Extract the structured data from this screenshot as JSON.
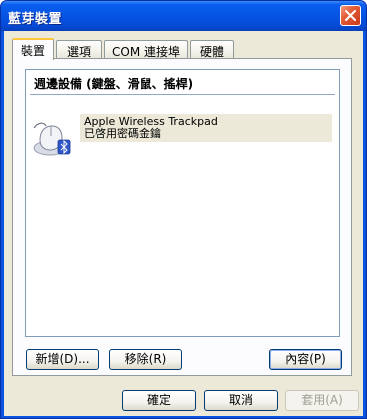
{
  "window": {
    "title": "藍芽裝置"
  },
  "tabs": [
    {
      "label": "裝置",
      "active": true
    },
    {
      "label": "選項",
      "active": false
    },
    {
      "label": "COM 連接埠",
      "active": false
    },
    {
      "label": "硬體",
      "active": false
    }
  ],
  "device_list": {
    "group_header": "週邊設備 (鍵盤、滑鼠、搖桿)",
    "devices": [
      {
        "name": "Apple Wireless Trackpad",
        "status": "已啓用密碼金鑰",
        "icon": "mouse-icon"
      }
    ]
  },
  "panel_buttons": {
    "add": "新增(D)...",
    "remove": "移除(R)",
    "properties": "內容(P)"
  },
  "footer_buttons": {
    "ok": "確定",
    "cancel": "取消",
    "apply": "套用(A)"
  },
  "colors": {
    "titlebar": "#0654e3",
    "dialog_face": "#ece9d8",
    "active_tab_accent": "#ffc83c"
  }
}
